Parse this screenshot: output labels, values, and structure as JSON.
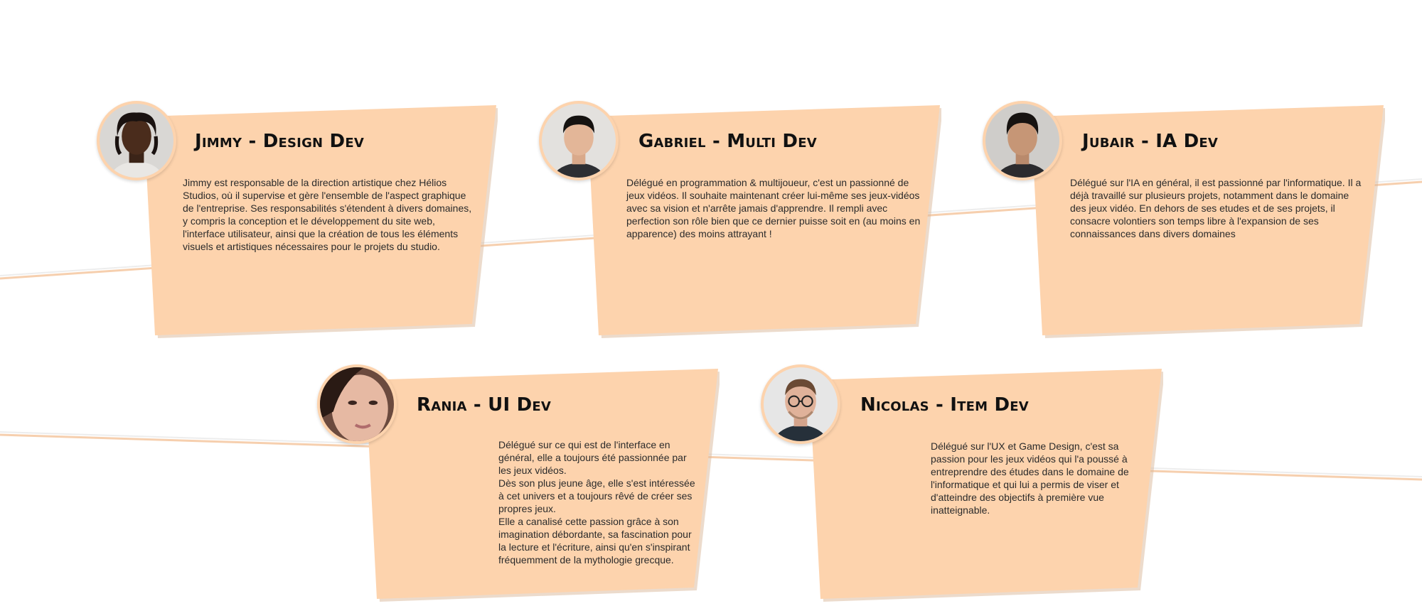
{
  "members": [
    {
      "name": "Jimmy - Design Dev",
      "description": "Jimmy est responsable de la direction artistique chez Hélios Studios, où il supervise et gère l'ensemble de l'aspect graphique de l'entreprise. Ses responsabilités s'étendent à divers domaines, y compris la conception et le développement du site web, l'interface utilisateur, ainsi que la création de tous les éléments visuels et artistiques nécessaires pour le projets du studio."
    },
    {
      "name": "Gabriel - Multi Dev",
      "description": "Délégué en programmation & multijoueur, c'est un passionné de jeux vidéos. Il souhaite maintenant créer lui-même ses jeux-vidéos avec sa vision et n'arrête jamais d'apprendre. Il rempli avec perfection son rôle bien que ce dernier puisse soit en (au moins en apparence) des moins attrayant !"
    },
    {
      "name": "Jubair - IA Dev",
      "description": "Délégué sur l'IA en général, il est passionné par l'informatique. Il a déjà travaillé sur plusieurs projets, notamment dans le domaine des jeux vidéo. En dehors de ses etudes et de ses projets, il consacre volontiers son temps libre à l'expansion de ses connaissances dans divers domaines"
    },
    {
      "name": "Rania - UI Dev",
      "paragraphs": [
        "Délégué sur ce qui est de l'interface en général, elle a toujours été passionnée par les jeux vidéos.",
        "Dès son plus jeune âge, elle s'est intéressée à cet univers et a toujours rêvé de créer ses propres jeux.",
        "Elle a canalisé cette passion grâce à son imagination débordante, sa fascination pour la lecture et l'écriture, ainsi qu'en s'inspirant fréquemment de la mythologie grecque."
      ]
    },
    {
      "name": "Nicolas - Item Dev",
      "description": "Délégué sur l'UX et Game Design, c'est sa passion pour les jeux vidéos qui l'a poussé à entreprendre des études dans le domaine de l'informatique et qui lui a permis de viser et d'atteindre des objectifs à première vue inatteignable."
    }
  ],
  "colors": {
    "card": "#fdd3ad",
    "line": "#f6cfae",
    "text": "#2b2b2b"
  }
}
